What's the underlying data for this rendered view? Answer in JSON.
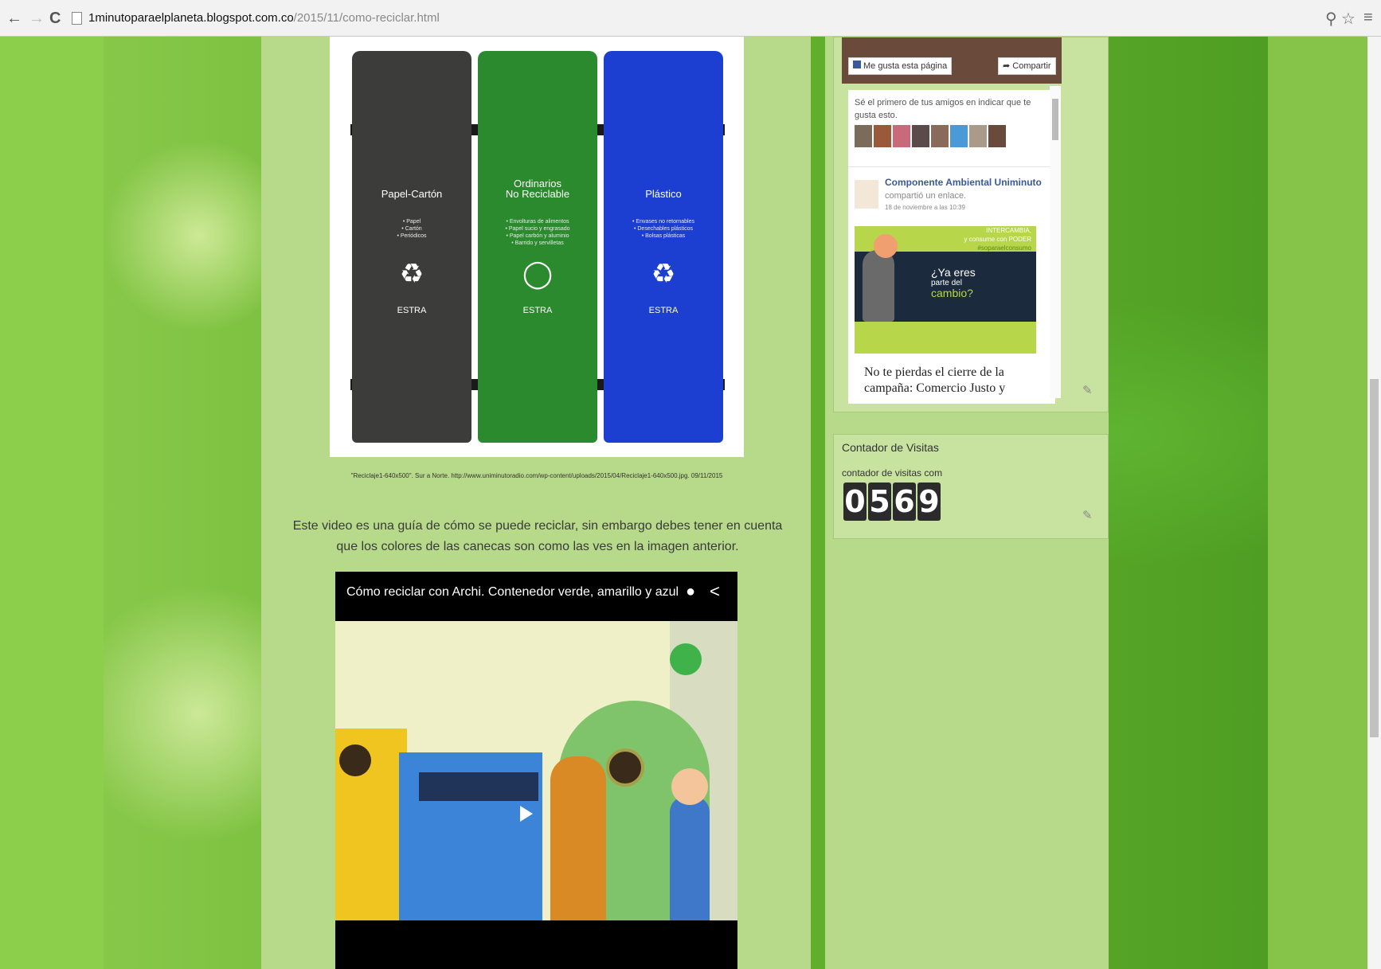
{
  "browser": {
    "url_host": "1minutoparaelplaneta.blogspot.com.co",
    "url_path": "/2015/11/como-reciclar.html",
    "back_icon": "←",
    "forward_icon": "→",
    "reload_icon": "C",
    "search_icon": "⚲",
    "star_icon": "☆",
    "menu_icon": "≡"
  },
  "bins_image": {
    "bins": [
      {
        "label": "Papel-Cartón",
        "items": "• Papel\n• Cartón\n• Periódicos",
        "brand": "ESTRA",
        "color": "#3c3d3b"
      },
      {
        "label": "Ordinarios\nNo Reciclable",
        "items": "• Envolturas de alimentos\n• Papel sucio y engrasado\n• Papel carbón y aluminio\n• Barrido y servilletas",
        "brand": "ESTRA",
        "color": "#2a8a2d"
      },
      {
        "label": "Plástico",
        "items": "• Envases no retornables\n• Desechables plásticos\n• Bolsas plásticas",
        "brand": "ESTRA",
        "color": "#1d3fd1"
      }
    ],
    "caption": "\"Reciclaje1-640x500\". Sur a Norte. http://www.uniminutoradio.com/wp-content/uploads/2015/04/Reciclaje1-640x500.jpg. 09/11/2015"
  },
  "intro_text": "Este video es una guía de cómo se puede reciclar, sin embargo debes tener en cuenta que los colores de las canecas son como las ves en la imagen anterior.",
  "video": {
    "title": "Cómo reciclar con Archi. Contenedor verde, amarillo y azul",
    "clock_icon": "●",
    "share_icon": "<"
  },
  "facebook_widget": {
    "like_button": "Me gusta esta página",
    "share_button": "Compartir",
    "friends_text": "Sé el primero de tus amigos en indicar que te gusta esto.",
    "page_name": "Componente Ambiental Uniminuto",
    "action": "compartió un enlace.",
    "date": "18 de noviembre a las 10:39",
    "post_image": {
      "line1": "INTERCAMBIA,",
      "line2": "y consume con PODER",
      "line3": "#soparaelconsumo",
      "slogan1": "¿Ya eres",
      "slogan2": "parte del",
      "slogan3": "cambio?"
    },
    "post_text": "No te pierdas el cierre de la campaña: Comercio Justo y"
  },
  "counter_widget": {
    "title": "Contador de Visitas",
    "subtitle": "contador de visitas com",
    "digits": [
      "0",
      "5",
      "6",
      "9"
    ]
  },
  "colors": {
    "page_green": "#7cc142",
    "post_column": "#b7d98a",
    "widget_bg": "#c7e39f",
    "facebook_blue": "#3b5998"
  }
}
